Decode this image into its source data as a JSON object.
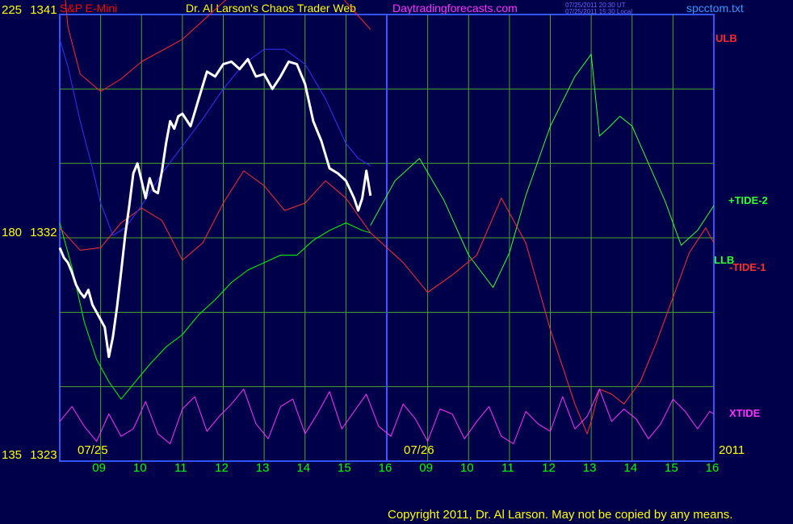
{
  "header": {
    "symbol": "S&P E-Mini",
    "title": "Dr. Al Larson's Chaos Trader Web",
    "site": "Daytradingforecasts.com",
    "stamp_ut": "07/25/2011 20:30 UT",
    "stamp_local": "07/25/2011 15:30 Local",
    "file": "spcctom.txt",
    "symbol_color": "#ff0000",
    "title_color": "#ffff00",
    "site_color": "#ff33ff",
    "file_color": "#3399ff"
  },
  "chart_data": {
    "type": "line",
    "title": "Dr. Al Larson's Chaos Trader Web",
    "subtitle": "S&P E-Mini",
    "y_axis": {
      "labels": [
        {
          "left": "225",
          "right": "1341",
          "value": 1341
        },
        {
          "left": "180",
          "right": "1332",
          "value": 1332
        },
        {
          "left": "135",
          "right": "1323",
          "value": 1323
        }
      ],
      "ylim": [
        1323,
        1341
      ]
    },
    "x_axis": {
      "ticks": [
        "09",
        "10",
        "11",
        "12",
        "13",
        "14",
        "15",
        "16",
        "09",
        "10",
        "11",
        "12",
        "13",
        "14",
        "15",
        "16"
      ],
      "xlim": [
        0,
        16
      ],
      "date_labels": [
        "07/25",
        "07/26",
        "2011"
      ]
    },
    "grid": true,
    "series": [
      {
        "name": "ULB",
        "color": "#ff2a2a",
        "x": [
          0,
          0.2,
          0.5,
          1,
          1.5,
          2,
          3,
          4,
          5,
          6,
          7,
          7.6
        ],
        "y": [
          1344,
          1340.5,
          1338.6,
          1337.9,
          1338.4,
          1339.1,
          1340,
          1341.5,
          1342.8,
          1343.7,
          1341.5,
          1340.4
        ]
      },
      {
        "name": "LLB",
        "color": "#00ff00",
        "x": [
          0,
          0.3,
          0.6,
          0.9,
          1.2,
          1.5,
          1.8,
          2.2,
          2.6,
          3.0,
          3.4,
          3.8,
          4.2,
          4.6,
          5.0,
          5.4,
          5.8,
          6.2,
          6.6,
          7.0,
          7.4,
          7.6
        ],
        "y": [
          1332.6,
          1330.8,
          1328.6,
          1327.1,
          1326.2,
          1325.5,
          1326.1,
          1326.9,
          1327.6,
          1328.1,
          1328.9,
          1329.5,
          1330.2,
          1330.7,
          1331,
          1331.3,
          1331.3,
          1331.9,
          1332.3,
          1332.6,
          1332.3,
          1332.2
        ]
      },
      {
        "name": "+TIDE-2",
        "color": "#33ff33",
        "x": [
          7.6,
          8.2,
          8.8,
          9.4,
          10.0,
          10.6,
          11.0,
          11.4,
          12.0,
          12.6,
          13.0,
          13.2,
          13.4,
          13.7,
          14.0,
          14.4,
          14.8,
          15.2,
          15.6,
          16.0
        ],
        "y": [
          1332.5,
          1334.3,
          1335.2,
          1333.5,
          1331.3,
          1330,
          1331.4,
          1333.7,
          1336.5,
          1338.5,
          1339.4,
          1336.1,
          1336.4,
          1336.9,
          1336.5,
          1335,
          1333.5,
          1331.7,
          1332.3,
          1333.3
        ]
      },
      {
        "name": "-TIDE-1",
        "color": "#ff3030",
        "x": [
          0,
          0.5,
          1,
          1.5,
          2,
          2.5,
          3,
          3.5,
          4,
          4.5,
          5,
          5.5,
          6,
          6.5,
          7,
          7.6,
          8.4,
          9.0,
          9.6,
          10.2,
          10.8,
          11.4,
          12.0,
          12.6,
          12.9,
          13.0,
          13.2,
          13.5,
          13.8,
          14.2,
          14.6,
          15.0,
          15.4,
          15.8,
          16.0
        ],
        "y": [
          1332.4,
          1331.5,
          1331.6,
          1332.6,
          1333.2,
          1332.7,
          1331.1,
          1331.8,
          1333.4,
          1334.7,
          1334.1,
          1333.1,
          1333.4,
          1334.3,
          1333.6,
          1332.2,
          1331,
          1329.8,
          1330.5,
          1331.3,
          1333.6,
          1331.8,
          1328.3,
          1325.3,
          1324.1,
          1324.6,
          1325.9,
          1325.7,
          1325.3,
          1326.2,
          1327.8,
          1329.6,
          1331.4,
          1332.4,
          1331.8
        ]
      },
      {
        "name": "XTIDE",
        "color": "#ff33ff",
        "x": [
          0,
          0.3,
          0.6,
          0.9,
          1.2,
          1.5,
          1.8,
          2.1,
          2.4,
          2.7,
          3.0,
          3.3,
          3.6,
          3.9,
          4.2,
          4.5,
          4.8,
          5.1,
          5.4,
          5.7,
          6.0,
          6.3,
          6.6,
          6.9,
          7.2,
          7.5,
          7.8,
          8.1,
          8.4,
          8.7,
          9.0,
          9.3,
          9.6,
          9.9,
          10.2,
          10.5,
          10.8,
          11.1,
          11.4,
          11.7,
          12.0,
          12.3,
          12.6,
          12.9,
          13.2,
          13.5,
          13.8,
          14.1,
          14.4,
          14.7,
          15.0,
          15.3,
          15.6,
          15.9,
          16.0
        ],
        "y": [
          1324.6,
          1325.2,
          1324.4,
          1323.8,
          1324.9,
          1324.0,
          1324.3,
          1325.4,
          1324.1,
          1323.7,
          1325.1,
          1325.6,
          1324.2,
          1324.8,
          1325.3,
          1325.9,
          1324.5,
          1323.9,
          1325.2,
          1325.5,
          1324.1,
          1324.9,
          1325.8,
          1324.3,
          1325.0,
          1325.7,
          1324.4,
          1324.0,
          1325.3,
          1324.7,
          1323.8,
          1325.1,
          1324.9,
          1323.9,
          1324.6,
          1325.2,
          1324.0,
          1323.7,
          1325.0,
          1324.5,
          1324.2,
          1325.6,
          1324.3,
          1324.8,
          1325.9,
          1324.6,
          1325.1,
          1324.7,
          1323.9,
          1324.5,
          1325.5,
          1325.0,
          1324.3,
          1325.0,
          1324.9
        ]
      },
      {
        "name": "EMA",
        "color": "#3333ff",
        "x": [
          0,
          0.2,
          0.5,
          0.8,
          1.0,
          1.3,
          1.6,
          2.0,
          2.5,
          3.0,
          3.5,
          4.0,
          4.5,
          5.0,
          5.5,
          6.0,
          6.5,
          7.0,
          7.3,
          7.6
        ],
        "y": [
          1340,
          1338.9,
          1336.7,
          1334.8,
          1333.4,
          1332.1,
          1332.4,
          1333.3,
          1334.6,
          1335.7,
          1336.8,
          1338.0,
          1339.0,
          1339.6,
          1339.6,
          1339.0,
          1337.6,
          1335.8,
          1335.2,
          1334.9
        ]
      },
      {
        "name": "Price",
        "color": "#ffffff",
        "x": [
          0,
          0.1,
          0.2,
          0.3,
          0.4,
          0.5,
          0.6,
          0.7,
          0.8,
          0.9,
          1.0,
          1.1,
          1.2,
          1.3,
          1.4,
          1.5,
          1.6,
          1.7,
          1.8,
          1.9,
          2.0,
          2.1,
          2.2,
          2.3,
          2.4,
          2.5,
          2.6,
          2.7,
          2.8,
          2.9,
          3.0,
          3.2,
          3.4,
          3.6,
          3.8,
          4.0,
          4.2,
          4.4,
          4.6,
          4.8,
          5.0,
          5.2,
          5.4,
          5.6,
          5.8,
          6.0,
          6.2,
          6.4,
          6.6,
          6.8,
          7.0,
          7.2,
          7.3,
          7.4,
          7.5,
          7.6
        ],
        "y": [
          1331.6,
          1331.2,
          1331.0,
          1330.6,
          1330.1,
          1329.8,
          1329.6,
          1329.9,
          1329.3,
          1329.0,
          1328.7,
          1328.4,
          1327.2,
          1328.0,
          1329.2,
          1330.6,
          1332.1,
          1333.3,
          1334.6,
          1335.0,
          1334.3,
          1333.6,
          1334.4,
          1333.9,
          1333.8,
          1334.7,
          1335.8,
          1336.7,
          1336.4,
          1336.9,
          1337.0,
          1336.5,
          1337.6,
          1338.7,
          1338.5,
          1339.0,
          1339.1,
          1338.8,
          1339.2,
          1338.5,
          1338.6,
          1338.0,
          1338.5,
          1339.1,
          1339.0,
          1338.2,
          1336.7,
          1335.9,
          1334.8,
          1334.6,
          1334.3,
          1333.6,
          1333.1,
          1333.6,
          1334.7,
          1333.7
        ]
      }
    ],
    "labels": [
      "ULB",
      "+TIDE-2",
      "LLB",
      "-TIDE-1",
      "XTIDE"
    ]
  },
  "footer": {
    "copyright": "Copyright 2011, Dr. Al Larson. May not be copied by any means."
  }
}
